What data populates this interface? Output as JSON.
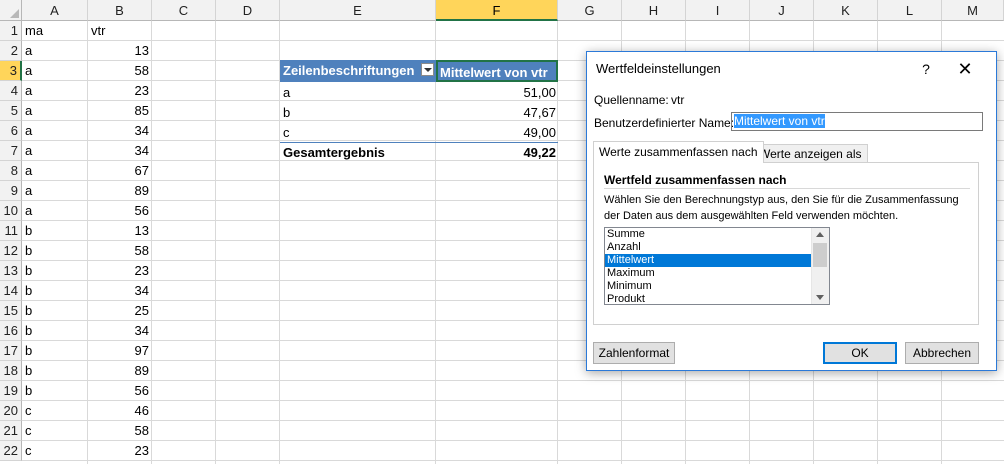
{
  "columns": [
    "A",
    "B",
    "C",
    "D",
    "E",
    "F",
    "G",
    "H",
    "I",
    "J",
    "K",
    "L",
    "M"
  ],
  "rows": [
    "1",
    "2",
    "3",
    "4",
    "5",
    "6",
    "7",
    "8",
    "9",
    "10",
    "11",
    "12",
    "13",
    "14",
    "15",
    "16",
    "17",
    "18",
    "19",
    "20",
    "21",
    "22"
  ],
  "data": {
    "header": [
      "ma",
      "vtr"
    ],
    "records": [
      [
        "a",
        "13"
      ],
      [
        "a",
        "58"
      ],
      [
        "a",
        "23"
      ],
      [
        "a",
        "85"
      ],
      [
        "a",
        "34"
      ],
      [
        "a",
        "34"
      ],
      [
        "a",
        "67"
      ],
      [
        "a",
        "89"
      ],
      [
        "a",
        "56"
      ],
      [
        "b",
        "13"
      ],
      [
        "b",
        "58"
      ],
      [
        "b",
        "23"
      ],
      [
        "b",
        "34"
      ],
      [
        "b",
        "25"
      ],
      [
        "b",
        "34"
      ],
      [
        "b",
        "97"
      ],
      [
        "b",
        "89"
      ],
      [
        "b",
        "56"
      ],
      [
        "c",
        "46"
      ],
      [
        "c",
        "58"
      ],
      [
        "c",
        "23"
      ]
    ]
  },
  "pivot": {
    "row_label_header": "Zeilenbeschriftungen",
    "value_header": "Mittelwert von vtr",
    "rows": [
      {
        "label": "a",
        "value": "51,00"
      },
      {
        "label": "b",
        "value": "47,67"
      },
      {
        "label": "c",
        "value": "49,00"
      }
    ],
    "total_label": "Gesamtergebnis",
    "total_value": "49,22"
  },
  "dialog": {
    "title": "Wertfeldeinstellungen",
    "help": "?",
    "close": "✕",
    "source_label": "Quellenname:",
    "source_value": "vtr",
    "custom_name_label": "Benutzerdefinierter Name:",
    "custom_name_value": "Mittelwert von vtr",
    "tabs": [
      "Werte zusammenfassen nach",
      "Werte anzeigen als"
    ],
    "section_title": "Wertfeld zusammenfassen nach",
    "description_1": "Wählen Sie den Berechnungstyp aus, den Sie für die Zusammenfassung",
    "description_2": "der Daten aus dem ausgewählten Feld verwenden möchten.",
    "options": [
      "Summe",
      "Anzahl",
      "Mittelwert",
      "Maximum",
      "Minimum",
      "Produkt"
    ],
    "selected_option": "Mittelwert",
    "number_format_button": "Zahlenformat",
    "ok_button": "OK",
    "cancel_button": "Abbrechen"
  }
}
